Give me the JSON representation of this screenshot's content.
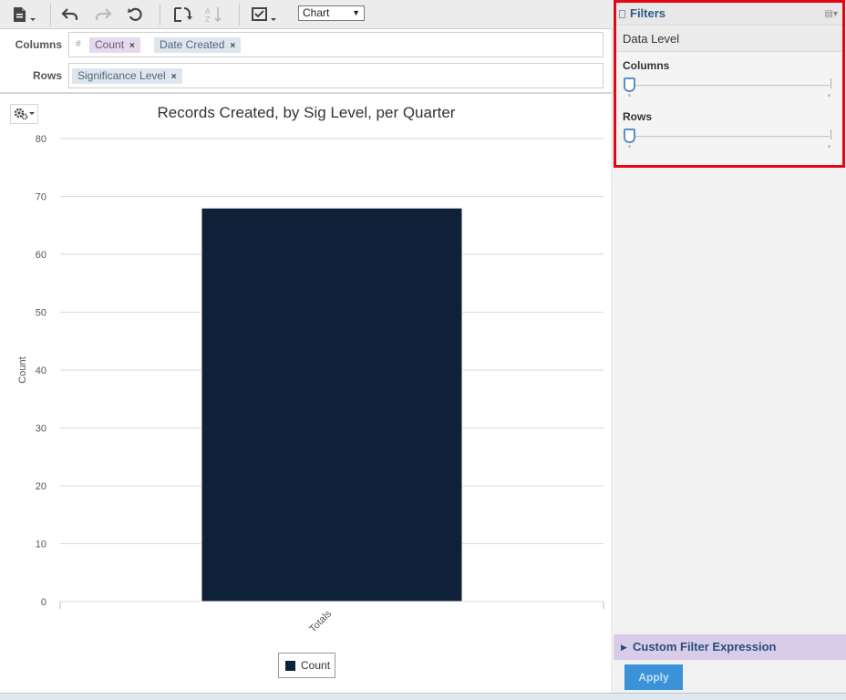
{
  "toolbar": {
    "view_select": "Chart",
    "icons": [
      "file-menu-icon",
      "undo-icon",
      "redo-icon",
      "reset-icon",
      "swap-axes-icon",
      "sort-icon",
      "checklist-menu-icon"
    ]
  },
  "shelves": {
    "columns_label": "Columns",
    "rows_label": "Rows",
    "measure_symbol": "#",
    "columns_pills": [
      "Count",
      "Date Created"
    ],
    "rows_pills": [
      "Significance Level"
    ],
    "remove_symbol": "×"
  },
  "chart_data": {
    "type": "bar",
    "title": "Records Created, by Sig Level, per Quarter",
    "categories": [
      "Totals"
    ],
    "series": [
      {
        "name": "Count",
        "values": [
          68
        ],
        "color": "#0f2138"
      }
    ],
    "xlabel": "",
    "ylabel": "Count",
    "ylim": [
      0,
      80
    ],
    "yticks": [
      0,
      10,
      20,
      30,
      40,
      50,
      60,
      70,
      80
    ],
    "grid": true,
    "legend": "bottom-center"
  },
  "filters": {
    "title": "Filters",
    "data_level": "Data Level",
    "columns_label": "Columns",
    "rows_label": "Rows",
    "columns_level": 0,
    "rows_level": 0
  },
  "custom_filter": {
    "label": "Custom Filter Expression"
  },
  "apply_label": "Apply",
  "colors": {
    "bar": "#0f2138",
    "highlight_border": "#e30613",
    "apply_button": "#3b92d6",
    "panel_header_text": "#2d5b89"
  }
}
